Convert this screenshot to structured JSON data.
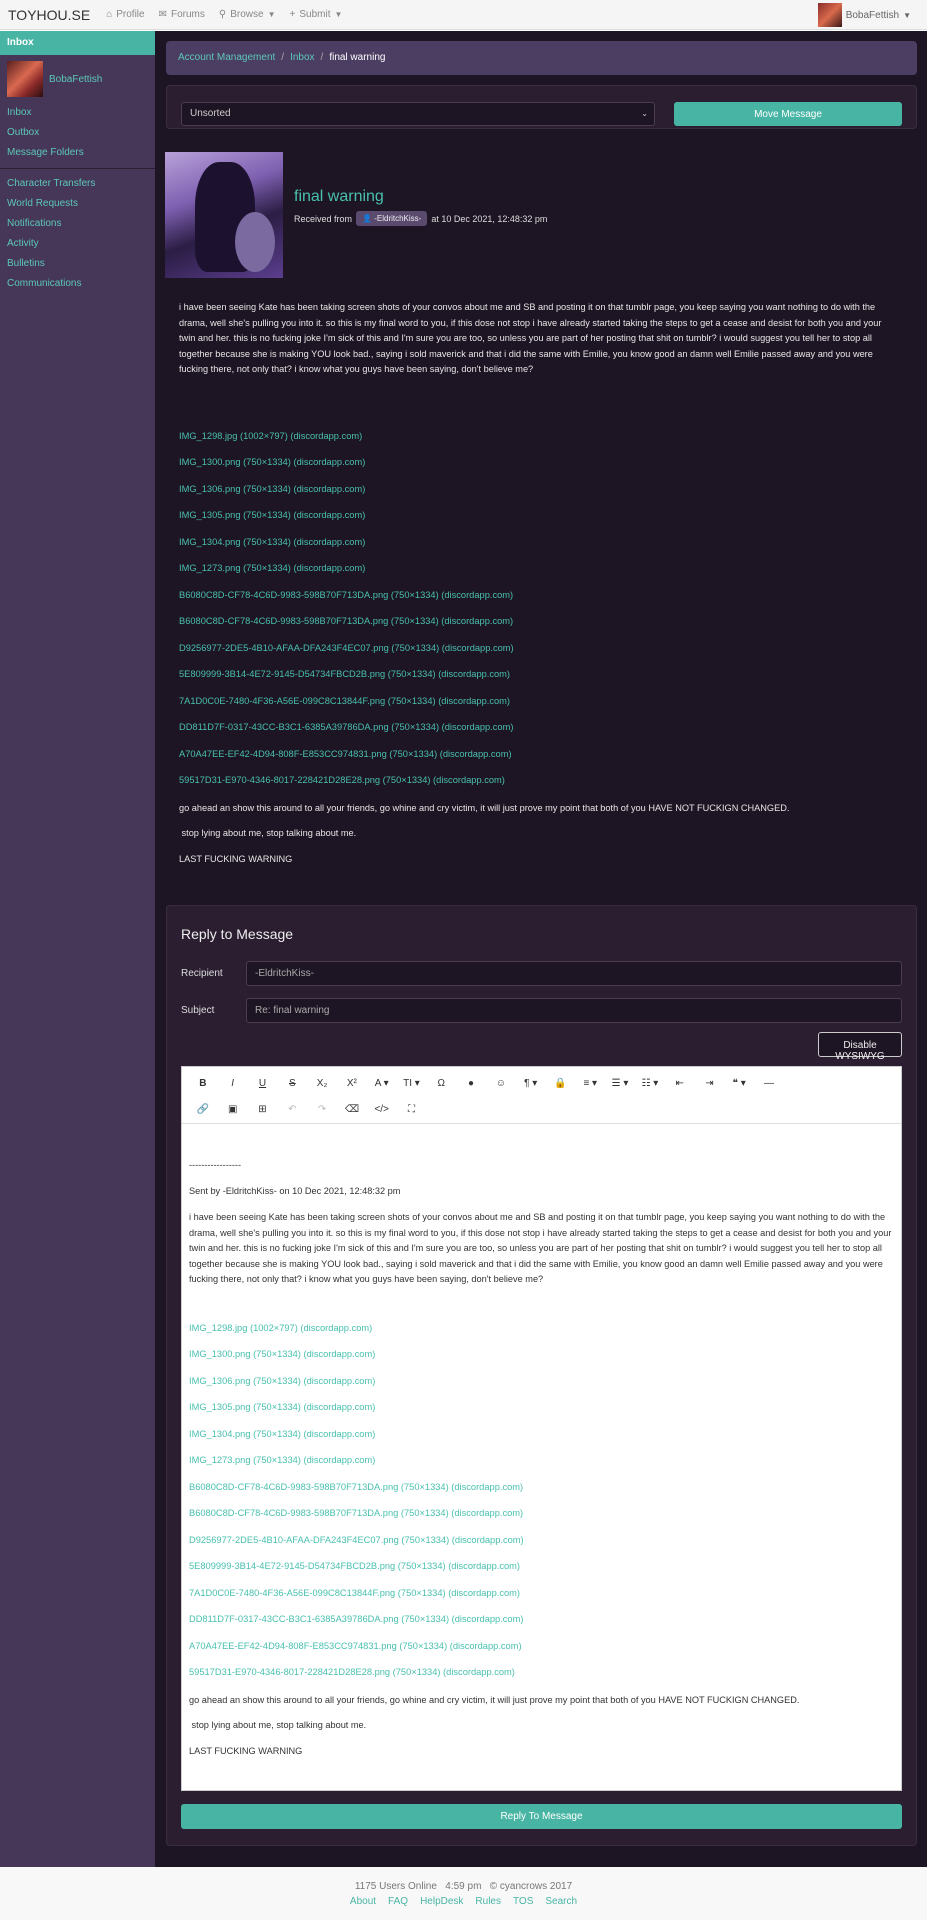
{
  "navbar": {
    "brand": "TOYHOU.SE",
    "items": [
      {
        "label": "Profile",
        "icon": "home-icon"
      },
      {
        "label": "Forums",
        "icon": "comments-icon"
      },
      {
        "label": "Browse",
        "icon": "search-icon"
      },
      {
        "label": "Submit",
        "icon": "plus-icon"
      }
    ],
    "username": "BobaFettish"
  },
  "sidebar": {
    "header": "Inbox",
    "username": "BobaFettish",
    "group1": [
      "Inbox",
      "Outbox",
      "Message Folders"
    ],
    "group2": [
      "Character Transfers",
      "World Requests",
      "Notifications",
      "Activity",
      "Bulletins",
      "Communications"
    ]
  },
  "breadcrumb": {
    "items": [
      "Account Management",
      "Inbox"
    ],
    "active": "final warning"
  },
  "controls": {
    "sort_value": "Unsorted",
    "move_button": "Move Message"
  },
  "message": {
    "title": "final warning",
    "received_from": "Received from",
    "sender": "-EldritchKiss-",
    "date": "at 10 Dec 2021, 12:48:32 pm",
    "body": "i have been seeing Kate has been taking screen shots of your convos about me and SB and posting it on that tumblr page, you keep saying you want nothing to do with the drama, well she's pulling you into it. so this is my final word to you, if this dose not stop i have already started taking the steps to get a cease and desist for both you and your twin and her. this is no fucking joke I'm sick of this and I'm sure you are too, so unless you are part of her posting that shit on tumblr? i would suggest you tell her to stop all together because she is making YOU look bad., saying i sold maverick and that i did the same with Emilie, you know good an damn well Emilie passed away and you were fucking there, not only that? i know what you guys have been saying, don't believe me?",
    "links": [
      "IMG_1298.jpg (1002×797) (discordapp.com)",
      "IMG_1300.png (750×1334) (discordapp.com)",
      "IMG_1306.png (750×1334) (discordapp.com)",
      "IMG_1305.png (750×1334) (discordapp.com)",
      "IMG_1304.png (750×1334) (discordapp.com)",
      "IMG_1273.png (750×1334) (discordapp.com)",
      "B6080C8D-CF78-4C6D-9983-598B70F713DA.png (750×1334) (discordapp.com)",
      "B6080C8D-CF78-4C6D-9983-598B70F713DA.png (750×1334) (discordapp.com)",
      "D9256977-2DE5-4B10-AFAA-DFA243F4EC07.png (750×1334) (discordapp.com)",
      "5E809999-3B14-4E72-9145-D54734FBCD2B.png (750×1334) (discordapp.com)",
      "7A1D0C0E-7480-4F36-A56E-099C8C13844F.png (750×1334) (discordapp.com)",
      "DD811D7F-0317-43CC-B3C1-6385A39786DA.png (750×1334) (discordapp.com)",
      "A70A47EE-EF42-4D94-808F-E853CC974831.png (750×1334) (discordapp.com)",
      "59517D31-E970-4346-8017-228421D28E28.png (750×1334) (discordapp.com)"
    ],
    "line1": "go ahead an show this around to all your friends, go whine and cry victim, it will just prove my point that both of you HAVE NOT FUCKIGN CHANGED.",
    "line2": " stop lying about me, stop talking about me.",
    "line3": "LAST FUCKING WARNING"
  },
  "reply": {
    "title": "Reply to Message",
    "recipient_label": "Recipient",
    "recipient_value": "-EldritchKiss-",
    "subject_label": "Subject",
    "subject_value": "Re: final warning",
    "wysiwyg_button": "Disable WYSIWYG",
    "separator": "-----------------",
    "sent_by": "Sent by -EldritchKiss- on 10 Dec 2021, 12:48:32 pm",
    "submit_button": "Reply To Message"
  },
  "toolbar": {
    "row1": [
      {
        "glyph": "B",
        "icon": "bold-icon"
      },
      {
        "glyph": "I",
        "icon": "italic-icon"
      },
      {
        "glyph": "U",
        "icon": "underline-icon"
      },
      {
        "glyph": "S",
        "icon": "strikethrough-icon"
      },
      {
        "glyph": "X₂",
        "icon": "subscript-icon"
      },
      {
        "glyph": "X²",
        "icon": "superscript-icon"
      },
      {
        "glyph": "A ▾",
        "icon": "font-family-icon"
      },
      {
        "glyph": "TI ▾",
        "icon": "font-size-icon"
      },
      {
        "glyph": "Ω",
        "icon": "special-chars-icon"
      },
      {
        "glyph": "●",
        "icon": "color-icon"
      },
      {
        "glyph": "☺",
        "icon": "emoticon-icon"
      },
      {
        "glyph": "¶ ▾",
        "icon": "paragraph-format-icon"
      },
      {
        "glyph": "🔒",
        "icon": "lock-icon"
      },
      {
        "glyph": "≡ ▾",
        "icon": "align-icon"
      },
      {
        "glyph": "☰ ▾",
        "icon": "ordered-list-icon"
      },
      {
        "glyph": "☷ ▾",
        "icon": "unordered-list-icon"
      },
      {
        "glyph": "⇤",
        "icon": "outdent-icon"
      },
      {
        "glyph": "⇥",
        "icon": "indent-icon"
      },
      {
        "glyph": "❝ ▾",
        "icon": "quote-icon"
      },
      {
        "glyph": "—",
        "icon": "horizontal-rule-icon"
      }
    ],
    "row2": [
      {
        "glyph": "🔗",
        "icon": "link-icon"
      },
      {
        "glyph": "▣",
        "icon": "image-icon"
      },
      {
        "glyph": "⊞",
        "icon": "table-icon"
      },
      {
        "glyph": "↶",
        "icon": "undo-icon"
      },
      {
        "glyph": "↷",
        "icon": "redo-icon"
      },
      {
        "glyph": "⌫",
        "icon": "clear-formatting-icon"
      },
      {
        "glyph": "</>",
        "icon": "code-view-icon"
      },
      {
        "glyph": "⛶",
        "icon": "fullscreen-icon"
      }
    ]
  },
  "footer": {
    "users_online": "1175 Users Online",
    "time": "4:59 pm",
    "copyright": "© cyancrows 2017",
    "links": [
      "About",
      "FAQ",
      "HelpDesk",
      "Rules",
      "TOS",
      "Search"
    ]
  }
}
